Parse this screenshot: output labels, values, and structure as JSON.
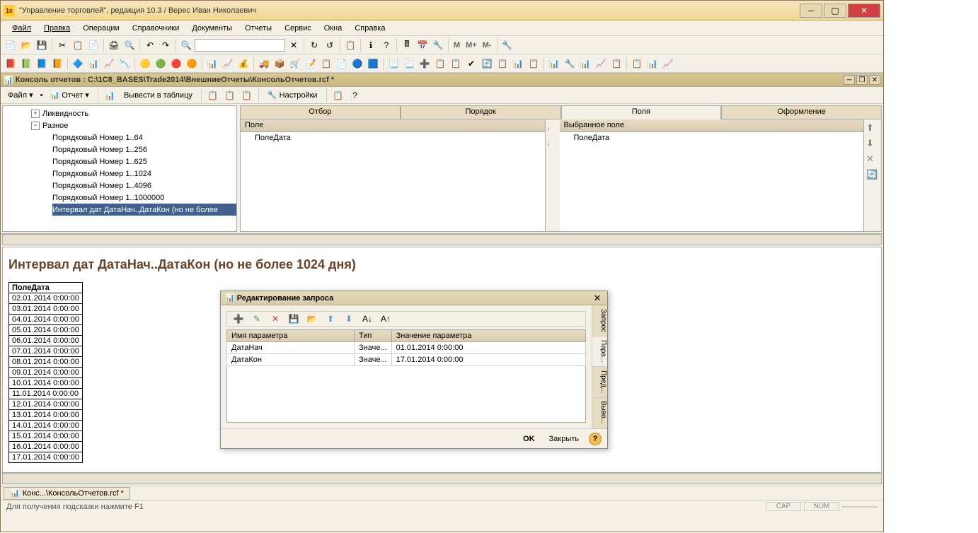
{
  "titlebar": {
    "icon": "1c",
    "text": "\"Управление торговлей\", редакция 10.3 / Верес Иван Николаевич"
  },
  "menubar": [
    "Файл",
    "Правка",
    "Операции",
    "Справочники",
    "Документы",
    "Отчеты",
    "Сервис",
    "Окна",
    "Справка"
  ],
  "subwindow": {
    "title": "Консоль отчетов : C:\\1C8_BASES\\Trade2014\\ВнешниеОтчеты\\КонсольОтчетов.rcf *"
  },
  "sub_toolbar": {
    "file": "Файл",
    "report": "Отчет",
    "output": "Вывести в таблицу",
    "settings": "Настройки"
  },
  "tree": {
    "node1": "Ликвидность",
    "node2": "Разное",
    "children": [
      "Порядковый Номер 1..64",
      "Порядковый Номер 1..256",
      "Порядковый Номер 1..625",
      "Порядковый Номер 1..1024",
      "Порядковый Номер 1..4096",
      "Порядковый Номер 1..1000000",
      "Интервал дат ДатаНач..ДатаКон (но не более"
    ]
  },
  "tabs": [
    "Отбор",
    "Порядок",
    "Поля",
    "Оформление"
  ],
  "fields": {
    "left_header": "Поле",
    "left_item": "ПолеДата",
    "right_header": "Выбранное поле",
    "right_item": "ПолеДата"
  },
  "report": {
    "title": "Интервал дат ДатаНач..ДатаКон (но не более 1024 дня)",
    "col_header": "ПолеДата",
    "rows": [
      "02.01.2014 0:00:00",
      "03.01.2014 0:00:00",
      "04.01.2014 0:00:00",
      "05.01.2014 0:00:00",
      "06.01.2014 0:00:00",
      "07.01.2014 0:00:00",
      "08.01.2014 0:00:00",
      "09.01.2014 0:00:00",
      "10.01.2014 0:00:00",
      "11.01.2014 0:00:00",
      "12.01.2014 0:00:00",
      "13.01.2014 0:00:00",
      "14.01.2014 0:00:00",
      "15.01.2014 0:00:00",
      "16.01.2014 0:00:00",
      "17.01.2014 0:00:00"
    ]
  },
  "dialog": {
    "title": "Редактирование запроса",
    "headers": [
      "Имя параметра",
      "Тип",
      "Значение параметра"
    ],
    "rows": [
      {
        "name": "ДатаНач",
        "type": "Значе...",
        "value": "01.01.2014 0:00:00"
      },
      {
        "name": "ДатаКон",
        "type": "Значе...",
        "value": "17.01.2014 0:00:00"
      }
    ],
    "side_tabs": [
      "Запрос",
      "Пара...",
      "Пред...",
      "Выво..."
    ],
    "ok": "OK",
    "close": "Закрыть"
  },
  "status_tab": "Конс...\\КонсольОтчетов.rcf *",
  "statusbar": {
    "hint": "Для получения подсказки нажмите F1",
    "cap": "CAP",
    "num": "NUM"
  }
}
